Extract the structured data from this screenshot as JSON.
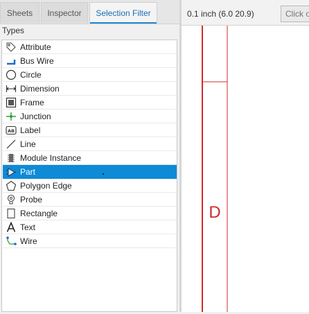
{
  "tabs": [
    {
      "label": "Sheets"
    },
    {
      "label": "Inspector"
    },
    {
      "label": "Selection Filter"
    }
  ],
  "panel": {
    "section_title": "Types",
    "items": [
      {
        "label": "Attribute",
        "icon": "tag-icon"
      },
      {
        "label": "Bus Wire",
        "icon": "bus-wire-icon"
      },
      {
        "label": "Circle",
        "icon": "circle-icon"
      },
      {
        "label": "Dimension",
        "icon": "dimension-icon"
      },
      {
        "label": "Frame",
        "icon": "frame-icon"
      },
      {
        "label": "Junction",
        "icon": "junction-icon"
      },
      {
        "label": "Label",
        "icon": "label-icon"
      },
      {
        "label": "Line",
        "icon": "line-icon"
      },
      {
        "label": "Module Instance",
        "icon": "module-instance-icon"
      },
      {
        "label": "Part",
        "icon": "part-icon",
        "selected": true
      },
      {
        "label": "Polygon Edge",
        "icon": "polygon-icon"
      },
      {
        "label": "Probe",
        "icon": "probe-icon"
      },
      {
        "label": "Rectangle",
        "icon": "rectangle-icon"
      },
      {
        "label": "Text",
        "icon": "text-icon"
      },
      {
        "label": "Wire",
        "icon": "wire-icon"
      }
    ]
  },
  "canvas": {
    "coordinate_readout": "0.1 inch (6.0 20.9)",
    "command_placeholder": "Click o",
    "frame_letter": "D",
    "frame_color": "#d12b2b"
  },
  "colors": {
    "selection": "#0e8ad6",
    "tab_accent": "#1e87d6"
  }
}
